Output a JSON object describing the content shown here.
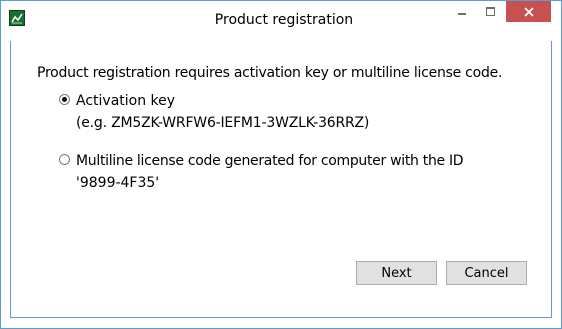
{
  "window": {
    "title": "Product registration",
    "border_color": "#5c9ad8",
    "close_button_color": "#c75050",
    "app_icon": "chart-app-icon"
  },
  "titlebar_controls": {
    "minimize_icon": "minimize-icon",
    "maximize_icon": "maximize-icon",
    "close_icon": "close-icon"
  },
  "content": {
    "intro": "Product registration requires activation key or multiline license code.",
    "options": [
      {
        "label": "Activation key",
        "detail": "(e.g. ZM5ZK-WRFW6-IEFM1-3WZLK-36RRZ)",
        "selected": true
      },
      {
        "label": "Multiline license code generated for computer with the ID",
        "detail": "'9899-4F35'",
        "selected": false
      }
    ]
  },
  "buttons": {
    "next": "Next",
    "cancel": "Cancel"
  }
}
